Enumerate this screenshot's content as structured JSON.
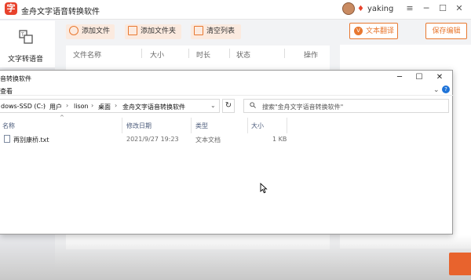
{
  "app": {
    "title": "金舟文字语音转换软件",
    "logo_glyph": "字",
    "user": "yaking",
    "window_controls": [
      "≡",
      "─",
      "☐",
      "✕"
    ]
  },
  "sidebar": {
    "items": [
      {
        "label": "文字转语音",
        "icon": "text-to-speech-icon"
      }
    ]
  },
  "toolbar": {
    "add_file": "添加文件",
    "add_folder": "添加文件夹",
    "clear_list": "清空列表",
    "translate": "文本翻译",
    "translate_badge": "V",
    "save_settings": "保存编辑"
  },
  "file_table": {
    "columns": [
      "文件名称",
      "大小",
      "时长",
      "状态",
      "操作"
    ]
  },
  "explorer": {
    "title": "音转换软件",
    "menu": "查看",
    "window_controls": [
      "─",
      "☐",
      "✕"
    ],
    "breadcrumbs": [
      "dows-SSD (C:)",
      "用户",
      "lison",
      "桌面",
      "金舟文字语音转换软件"
    ],
    "breadcrumb_separator": "›",
    "refresh": "↻",
    "search_placeholder": "搜索\"金舟文字语音转换软件\"",
    "columns": [
      "名称",
      "修改日期",
      "类型",
      "大小"
    ],
    "files": [
      {
        "name": "再别康桥.txt",
        "modified": "2021/9/27 19:23",
        "type": "文本文档",
        "size": "1 KB",
        "icon": "text-file-icon"
      }
    ]
  },
  "colors": {
    "brand": "#e8432d",
    "accent": "#e87830",
    "link": "#1e73d8"
  }
}
